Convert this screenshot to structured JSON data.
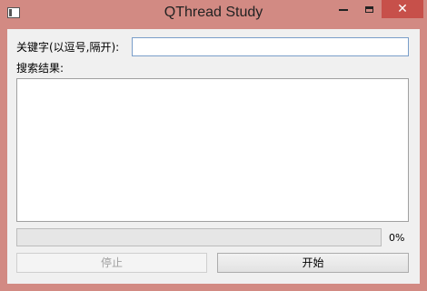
{
  "window": {
    "title": "QThread Study",
    "close_glyph": "✕",
    "colors": {
      "frame": "#d28a83",
      "close_button": "#c7504a",
      "client": "#f0f0f0"
    }
  },
  "form": {
    "keyword_label": "关键字(以逗号,隔开):",
    "keyword_value": "",
    "results_label": "搜索结果:",
    "results": []
  },
  "progress": {
    "value": 0,
    "text": "0%"
  },
  "buttons": {
    "stop_label": "停止",
    "stop_enabled": false,
    "start_label": "开始"
  },
  "icons": [
    "app-icon",
    "minimize-icon",
    "maximize-icon",
    "close-icon"
  ]
}
